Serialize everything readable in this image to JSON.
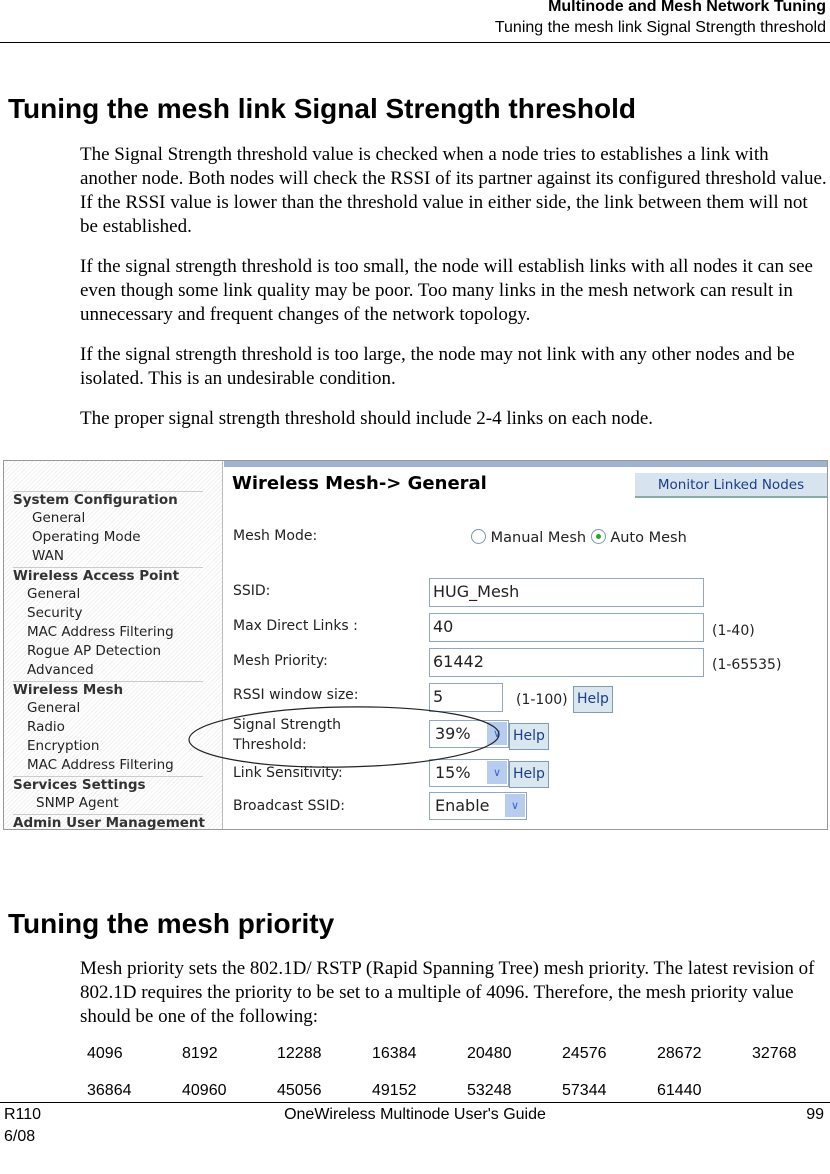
{
  "header": {
    "title": "Multinode and Mesh Network Tuning",
    "subtitle": "Tuning the mesh link Signal Strength threshold"
  },
  "section1": {
    "heading": "Tuning the mesh link Signal Strength threshold",
    "paragraphs": [
      "The Signal Strength threshold value is checked when a node tries to establishes a link with another node. Both nodes will check the RSSI of its partner against its configured threshold value. If the RSSI value is lower than the threshold value in either side, the link between them will not be established.",
      "If the signal strength threshold is too small, the node will establish links with all nodes it can see even though some link quality may be poor. Too many links in the mesh network can result in unnecessary and frequent changes of the network topology.",
      "If the signal strength threshold is too large, the node may not link with any other nodes and be isolated. This is an undesirable condition.",
      "The proper signal strength threshold should include 2-4 links on each node."
    ]
  },
  "screenshot": {
    "sidebar": [
      {
        "label": "System Configuration",
        "group": true
      },
      {
        "label": "General"
      },
      {
        "label": "Operating Mode"
      },
      {
        "label": "WAN"
      },
      {
        "label": "Wireless Access Point",
        "group": true
      },
      {
        "label": "General"
      },
      {
        "label": "Security"
      },
      {
        "label": "MAC Address Filtering"
      },
      {
        "label": "Rogue AP Detection"
      },
      {
        "label": "Advanced"
      },
      {
        "label": "Wireless Mesh",
        "group": true
      },
      {
        "label": "General"
      },
      {
        "label": "Radio"
      },
      {
        "label": "Encryption"
      },
      {
        "label": "MAC Address Filtering"
      },
      {
        "label": "Services Settings",
        "group": true
      },
      {
        "label": "SNMP Agent"
      },
      {
        "label": "Admin User Management",
        "group": true
      }
    ],
    "title": "Wireless Mesh-> General",
    "monitor_button": "Monitor Linked Nodes",
    "mesh_mode": {
      "label": "Mesh Mode:",
      "options": [
        "Manual Mesh",
        "Auto Mesh"
      ],
      "selected": "Auto Mesh"
    },
    "ssid": {
      "label": "SSID:",
      "value": "HUG_Mesh"
    },
    "max_links": {
      "label": "Max Direct Links :",
      "value": "40",
      "range": "(1-40)"
    },
    "priority": {
      "label": "Mesh Priority:",
      "value": "61442",
      "range": "(1-65535)"
    },
    "rssi": {
      "label": "RSSI window size:",
      "value": "5",
      "range": "(1-100)",
      "help": "Help"
    },
    "threshold": {
      "label1": "Signal Strength",
      "label2": "Threshold:",
      "value": "39%",
      "help": "Help"
    },
    "sensitivity": {
      "label": "Link Sensitivity:",
      "value": "15%",
      "help": "Help"
    },
    "broadcast": {
      "label": "Broadcast SSID:",
      "value": "Enable"
    }
  },
  "section2": {
    "heading": "Tuning the mesh priority",
    "paragraph": "Mesh priority sets the 802.1D/ RSTP (Rapid Spanning Tree) mesh priority. The latest revision of 802.1D requires the priority to be set to a multiple of 4096. Therefore, the mesh priority value should be one of the following:",
    "values": [
      [
        "4096",
        "8192",
        "12288",
        "16384",
        "20480",
        "24576",
        "28672",
        "32768"
      ],
      [
        "36864",
        "40960",
        "45056",
        "49152",
        "53248",
        "57344",
        "61440"
      ]
    ]
  },
  "footer": {
    "left": "R110",
    "date": "6/08",
    "center": "OneWireless Multinode User's Guide",
    "page": "99"
  }
}
